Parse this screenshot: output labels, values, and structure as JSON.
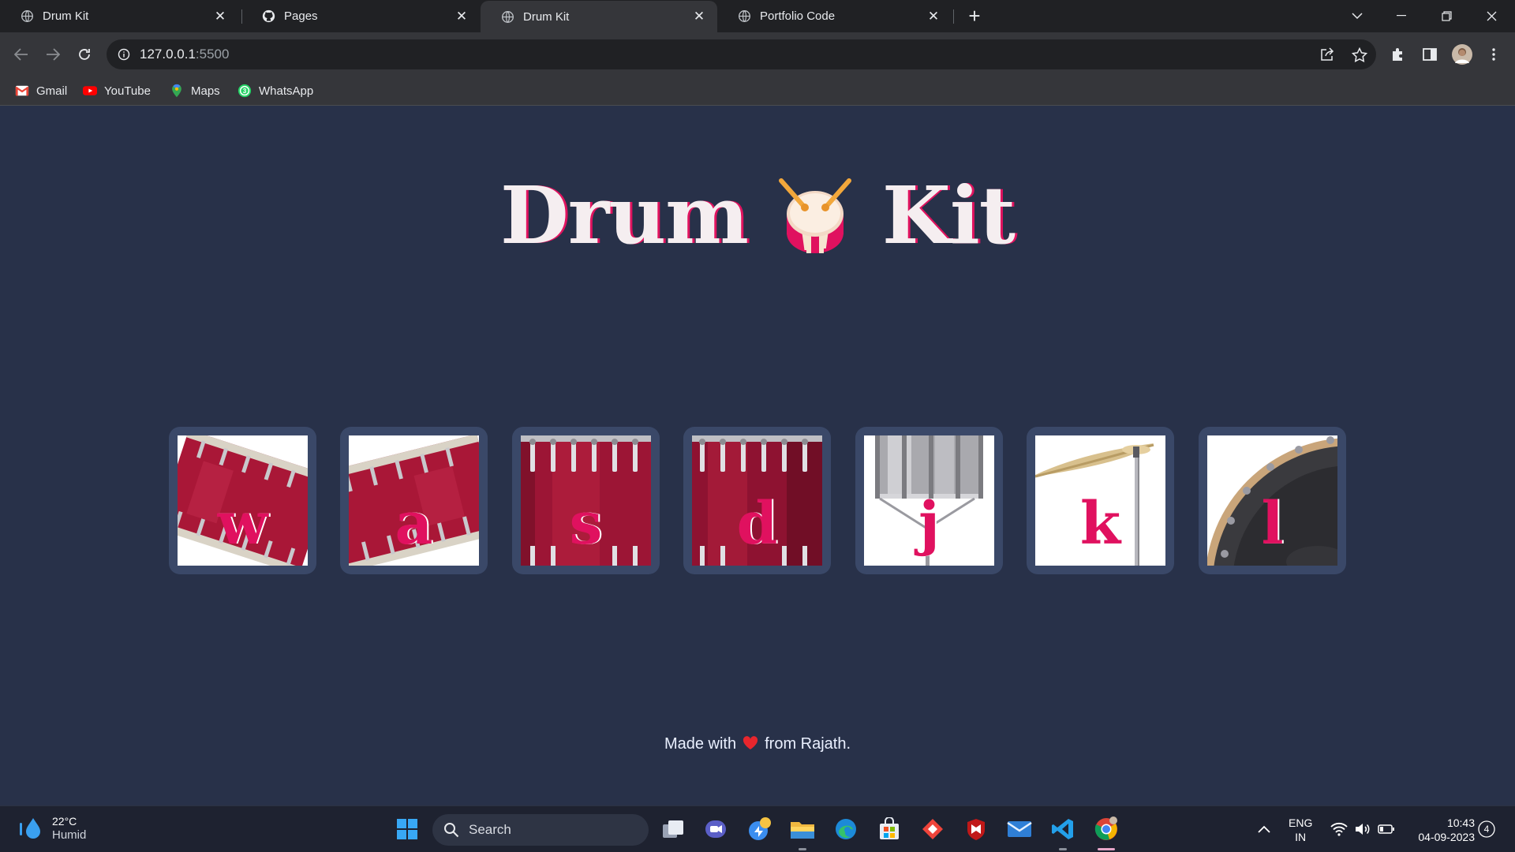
{
  "browser": {
    "tabs": [
      {
        "title": "Drum Kit",
        "icon": "globe-icon",
        "active": false
      },
      {
        "title": "Pages",
        "icon": "github-icon",
        "active": false
      },
      {
        "title": "Drum Kit",
        "icon": "globe-icon",
        "active": true
      },
      {
        "title": "Portfolio Code",
        "icon": "globe-icon",
        "active": false
      }
    ],
    "url_host": "127.0.0.1",
    "url_port": ":5500",
    "bookmarks": [
      {
        "label": "Gmail",
        "icon": "gmail-icon"
      },
      {
        "label": "YouTube",
        "icon": "youtube-icon"
      },
      {
        "label": "Maps",
        "icon": "maps-icon"
      },
      {
        "label": "WhatsApp",
        "icon": "whatsapp-icon"
      }
    ]
  },
  "page": {
    "title_left": "Drum",
    "title_right": "Kit",
    "title_icon": "drum-emoji",
    "drums": [
      {
        "key": "w",
        "instrument": "tom-1"
      },
      {
        "key": "a",
        "instrument": "tom-2"
      },
      {
        "key": "s",
        "instrument": "tom-3"
      },
      {
        "key": "d",
        "instrument": "tom-4"
      },
      {
        "key": "j",
        "instrument": "snare"
      },
      {
        "key": "k",
        "instrument": "crash"
      },
      {
        "key": "l",
        "instrument": "kick-bass"
      }
    ],
    "footer_pre": "Made with",
    "footer_post": "from Rajath.",
    "colors": {
      "background": "#283149",
      "accent": "#e0115f",
      "title_text": "#f5eef0"
    }
  },
  "taskbar": {
    "weather_temp": "22°C",
    "weather_condition": "Humid",
    "search_placeholder": "Search",
    "language_line1": "ENG",
    "language_line2": "IN",
    "time": "10:43",
    "date": "04-09-2023",
    "notification_count": "4"
  }
}
